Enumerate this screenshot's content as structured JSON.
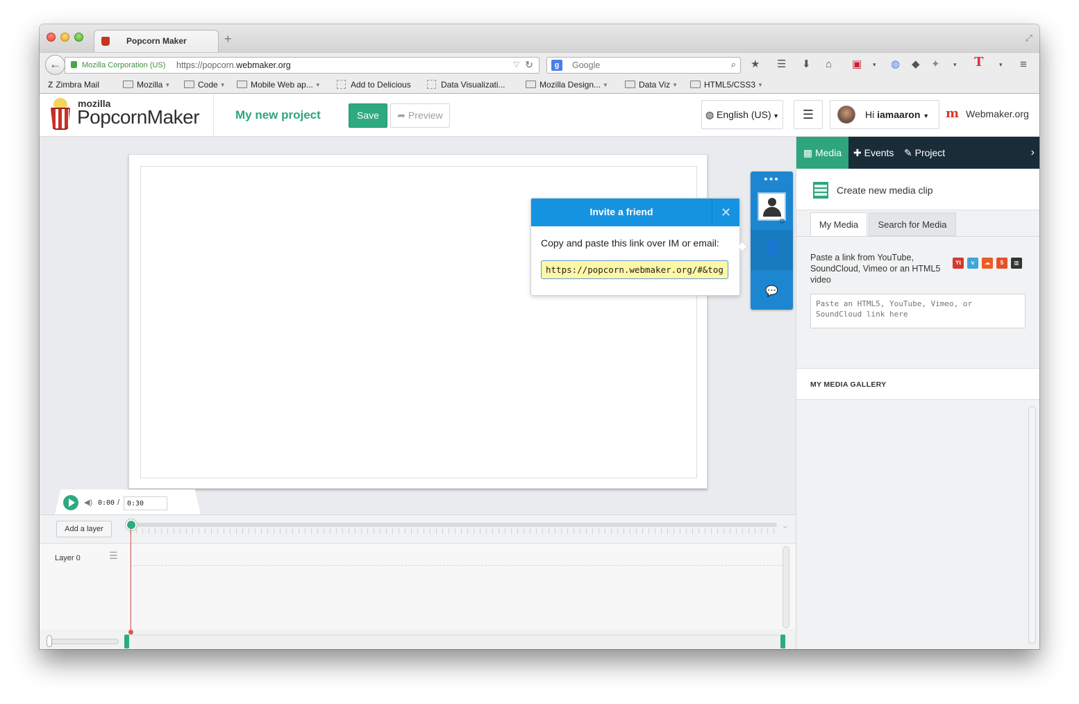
{
  "browser": {
    "tab_title": "Popcorn Maker",
    "new_tab": "+",
    "identity": "Mozilla Corporation (US)",
    "url_prefix": "https://popcorn.",
    "url_domain": "webmaker.org",
    "search_placeholder": "Google",
    "bookmarks": [
      {
        "label": "Zimbra Mail"
      },
      {
        "label": "Mozilla"
      },
      {
        "label": "Code"
      },
      {
        "label": "Mobile Web ap..."
      },
      {
        "label": "Add to Delicious"
      },
      {
        "label": "Data Visualizati..."
      },
      {
        "label": "Mozilla Design..."
      },
      {
        "label": "Data Viz"
      },
      {
        "label": "HTML5/CSS3"
      }
    ]
  },
  "header": {
    "logo_top": "mozilla",
    "logo_name": "PopcornMaker",
    "project_title": "My new project",
    "save_label": "Save",
    "preview_label": "Preview",
    "language": "English (US)",
    "greeting": "Hi",
    "username": "iamaaron",
    "webmaker_link": "Webmaker.org"
  },
  "invite": {
    "title": "Invite a friend",
    "instructions": "Copy and paste this link over IM or email:",
    "link": "https://popcorn.webmaker.org/#&together"
  },
  "timeline": {
    "current_time": "0:00",
    "separator": "/",
    "duration": "0:30",
    "add_layer_label": "Add a layer",
    "layer_name": "Layer 0"
  },
  "panel": {
    "tabs": {
      "media": "Media",
      "events": "Events",
      "project": "Project"
    },
    "create_clip": "Create new media clip",
    "media_tabs": {
      "mine": "My Media",
      "search": "Search for Media"
    },
    "paste_hint": "Paste a link from YouTube, SoundCloud, Vimeo or an HTML5 video",
    "input_placeholder": "Paste an HTML5, YouTube, Vimeo, or SoundCloud link here",
    "gallery_title": "MY MEDIA GALLERY"
  },
  "colors": {
    "accent_green": "#2faa80",
    "collab_blue": "#1d86d0",
    "panel_dark": "#1a2c38",
    "popcorn_red": "#c8312a"
  }
}
